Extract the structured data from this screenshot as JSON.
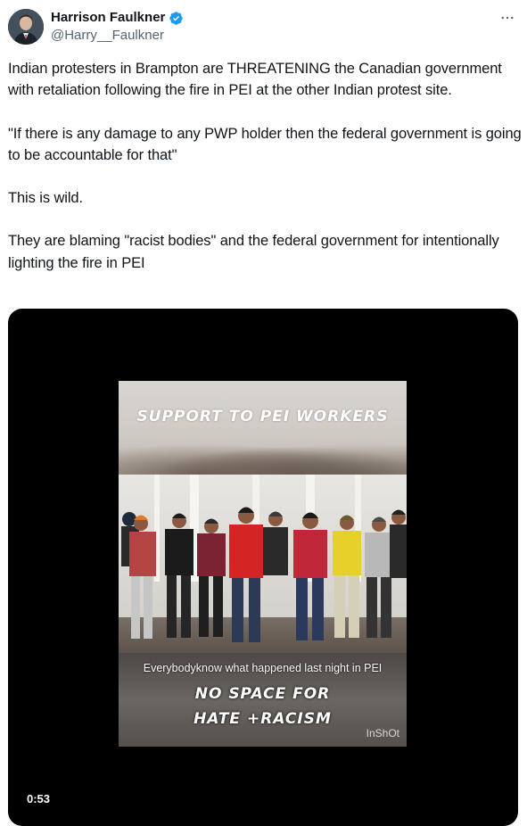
{
  "author": {
    "display_name": "Harrison Faulkner",
    "handle": "@Harry__Faulkner",
    "verified": true,
    "verified_color": "#1d9bf0"
  },
  "tweet": {
    "paragraphs": [
      "Indian protesters in Brampton are THREATENING the Canadian government with retaliation following the fire in PEI at the other Indian protest site.",
      "\"If there is any damage to any PWP holder then the federal government is going to be accountable for that\"",
      "This is wild.",
      "They are blaming \"racist bodies\" and the federal government for intentionally lighting the fire in PEI"
    ]
  },
  "video": {
    "title_overlay": "SUPPORT TO PEI WORKERS",
    "caption": "Everybodyknow what happened last night in PEI",
    "overlay_line_1": "NO SPACE FOR",
    "overlay_line_2": "HATE +RACISM",
    "watermark": "InShOt",
    "duration": "0:53"
  },
  "icons": {
    "more": "more-horizontal-icon",
    "verified": "verified-badge-icon"
  },
  "colors": {
    "text_primary": "#0f1419",
    "text_secondary": "#536471",
    "media_bg": "#000000"
  }
}
